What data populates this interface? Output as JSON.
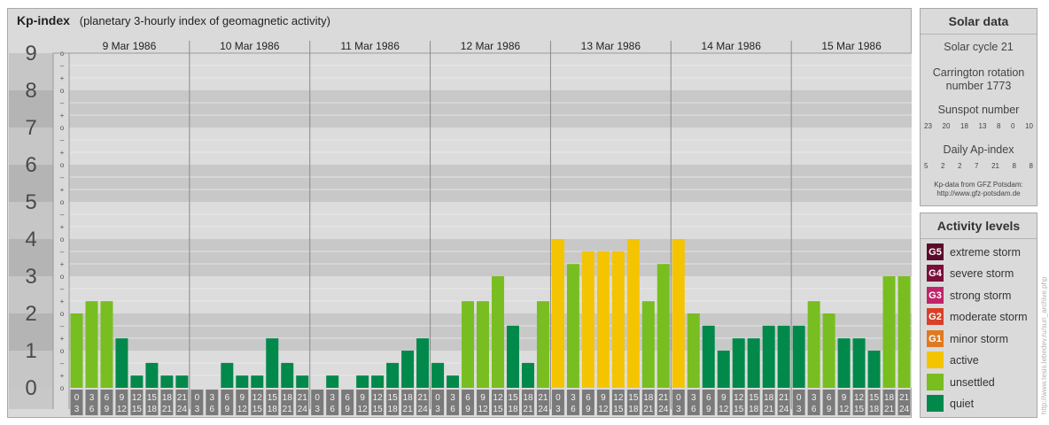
{
  "header": {
    "title": "Kp-index",
    "subtitle": "(planetary 3-hourly index of geomagnetic activity)"
  },
  "solar": {
    "title": "Solar data",
    "cycle": "Solar cycle 21",
    "carrington_line1": "Carrington rotation",
    "carrington_line2": "number 1773",
    "sunspot_label": "Sunspot number",
    "sunspot_values": [
      "23",
      "20",
      "18",
      "13",
      "8",
      "0",
      "10"
    ],
    "ap_label": "Daily Ap-index",
    "ap_values": [
      "5",
      "2",
      "2",
      "7",
      "21",
      "8",
      "8"
    ],
    "source_line1": "Kp-data from GFZ Potsdam:",
    "source_line2": "http://www.gfz-potsdam.de"
  },
  "activity": {
    "title": "Activity levels",
    "levels": [
      {
        "code": "G5",
        "label": "extreme storm",
        "color": "#5a0a2a"
      },
      {
        "code": "G4",
        "label": "severe storm",
        "color": "#7a0f3a"
      },
      {
        "code": "G3",
        "label": "strong storm",
        "color": "#c0246a"
      },
      {
        "code": "G2",
        "label": "moderate storm",
        "color": "#d8402a"
      },
      {
        "code": "G1",
        "label": "minor storm",
        "color": "#e07a20"
      },
      {
        "code": "",
        "label": "active",
        "color": "#f5c400"
      },
      {
        "code": "",
        "label": "unsettled",
        "color": "#78be20"
      },
      {
        "code": "",
        "label": "quiet",
        "color": "#00894a"
      }
    ]
  },
  "credit": "http://www.tesis.lebedev.ru/sun_archive.php",
  "chart_data": {
    "type": "bar",
    "title": "Kp-index",
    "y_ticks": [
      "0",
      "1",
      "2",
      "3",
      "4",
      "5",
      "6",
      "7",
      "8",
      "9"
    ],
    "minor_marks": [
      "+",
      "o",
      "–"
    ],
    "ylim": [
      0,
      9
    ],
    "days": [
      "9 Mar 1986",
      "10 Mar 1986",
      "11 Mar 1986",
      "12 Mar 1986",
      "13 Mar 1986",
      "14 Mar 1986",
      "15 Mar 1986"
    ],
    "hour_start": [
      "0",
      "3",
      "6",
      "9",
      "12",
      "15",
      "18",
      "21"
    ],
    "hour_end": [
      "3",
      "6",
      "9",
      "12",
      "15",
      "18",
      "21",
      "24"
    ],
    "thresholds": {
      "unsettled": 2,
      "active": 3.67
    },
    "colors": {
      "quiet": "#00894a",
      "unsettled": "#78be20",
      "active": "#f5c400"
    },
    "values": [
      2.0,
      2.33,
      2.33,
      1.33,
      0.33,
      0.67,
      0.33,
      0.33,
      0.0,
      0.0,
      0.67,
      0.33,
      0.33,
      1.33,
      0.67,
      0.33,
      0.0,
      0.33,
      0.0,
      0.33,
      0.33,
      0.67,
      1.0,
      1.33,
      0.67,
      0.33,
      2.33,
      2.33,
      3.0,
      1.67,
      0.67,
      2.33,
      4.0,
      3.33,
      3.67,
      3.67,
      3.67,
      4.0,
      2.33,
      3.33,
      4.0,
      2.0,
      1.67,
      1.0,
      1.33,
      1.33,
      1.67,
      1.67,
      1.67,
      2.33,
      2.0,
      1.33,
      1.33,
      1.0,
      3.0,
      3.0
    ]
  }
}
